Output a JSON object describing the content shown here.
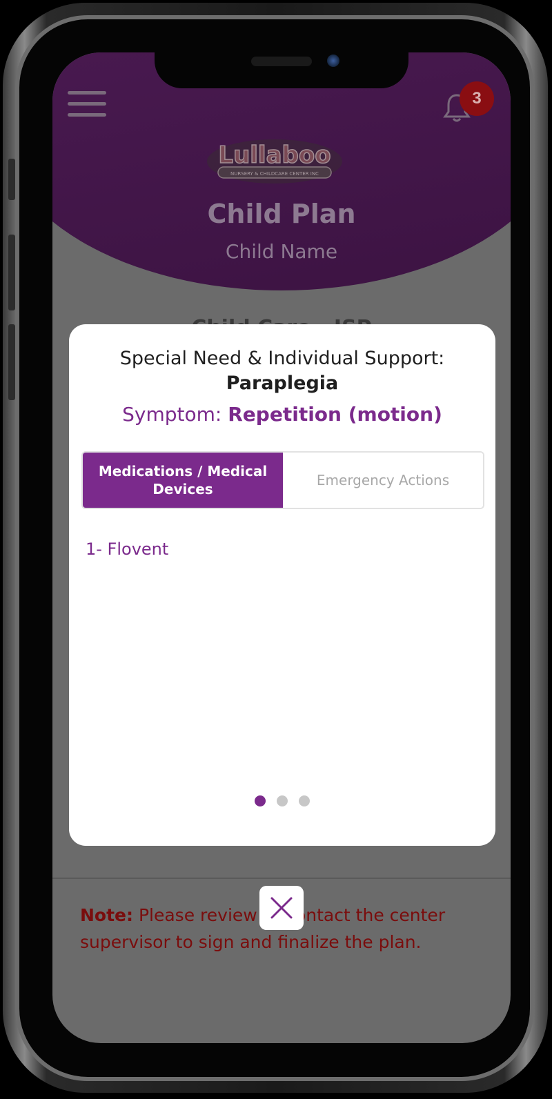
{
  "header": {
    "title": "Child Plan",
    "subtitle": "Child Name",
    "notification_count": "3",
    "logo_text": "Lullaboo",
    "logo_tagline": "NURSERY & CHILDCARE CENTER INC"
  },
  "background": {
    "partial_heading": "Child Care - ISP",
    "note_label": "Note:",
    "note_text": " Please review or contact the center supervisor to sign and finalize the plan."
  },
  "modal": {
    "title_prefix": "Special Need & Individual Support:",
    "title_condition": "Paraplegia",
    "symptom_label": "Symptom: ",
    "symptom_value": "Repetition (motion)",
    "tabs": [
      {
        "label": "Medications / Medical Devices",
        "active": true
      },
      {
        "label": "Emergency Actions",
        "active": false
      }
    ],
    "items": [
      "1- Flovent"
    ],
    "pagination": {
      "total": 3,
      "current": 1
    }
  },
  "colors": {
    "accent": "#7b2a8c",
    "badge": "#8a0e12",
    "note": "#7a0d0d"
  },
  "icons": [
    "hamburger-menu-icon",
    "bell-icon",
    "close-icon"
  ]
}
